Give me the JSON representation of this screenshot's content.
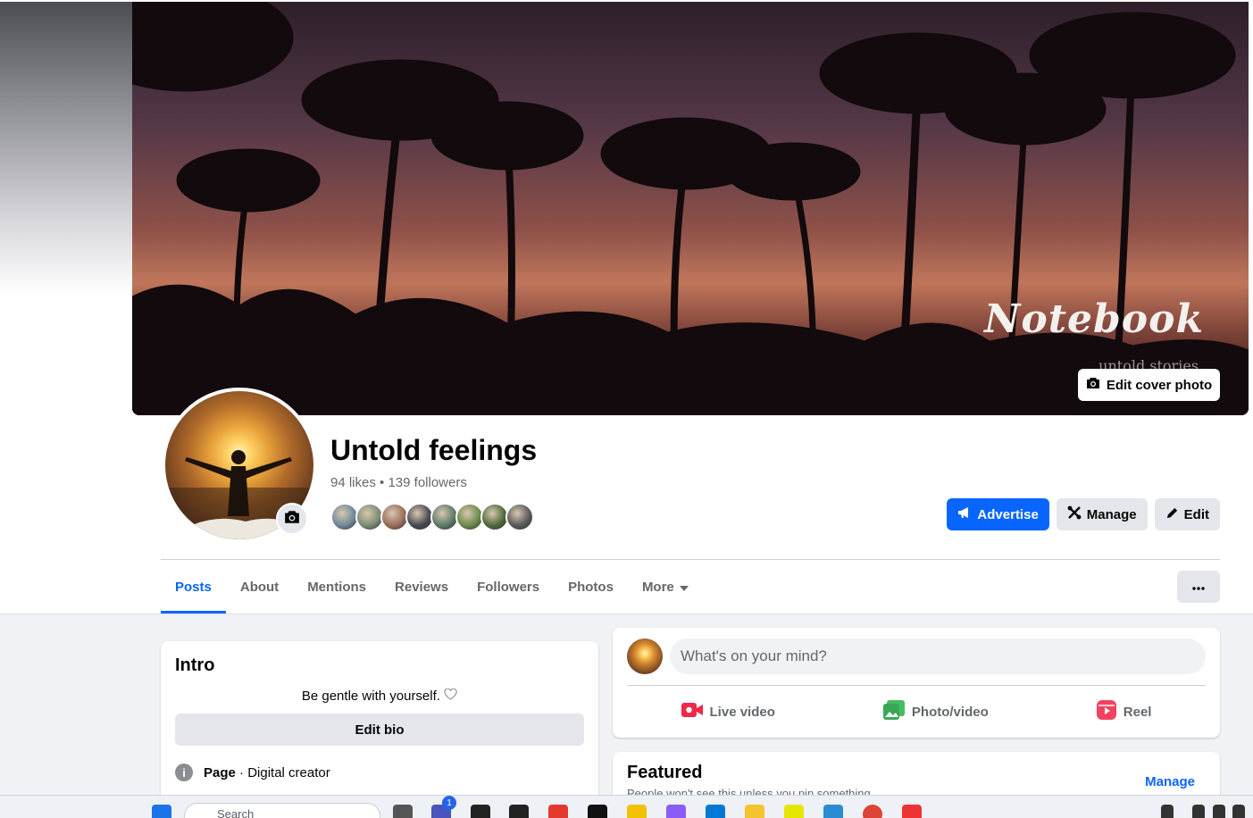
{
  "cover": {
    "brand": "Notebook",
    "subtitle": "untold stories",
    "edit_label": "Edit cover photo"
  },
  "profile": {
    "name": "Untold feelings",
    "likes": "94 likes",
    "separator": " • ",
    "followers": "139 followers"
  },
  "actions": {
    "advertise": "Advertise",
    "manage": "Manage",
    "edit": "Edit"
  },
  "tabs": [
    {
      "label": "Posts",
      "active": true
    },
    {
      "label": "About"
    },
    {
      "label": "Mentions"
    },
    {
      "label": "Reviews"
    },
    {
      "label": "Followers"
    },
    {
      "label": "Photos"
    },
    {
      "label": "More"
    }
  ],
  "intro": {
    "title": "Intro",
    "bio": "Be gentle with yourself.",
    "edit_bio": "Edit bio",
    "page_label": "Page",
    "page_category": " · Digital creator"
  },
  "composer": {
    "placeholder": "What's on your mind?",
    "live_video": "Live video",
    "photo_video": "Photo/video",
    "reel": "Reel"
  },
  "featured": {
    "title": "Featured",
    "subtitle": "People won't see this unless you pin something.",
    "manage": "Manage"
  },
  "taskbar": {
    "search_placeholder": "Search",
    "badge_count": "1"
  },
  "colors": {
    "accent": "#0866ff",
    "secondary_button": "#e4e6eb",
    "muted_text": "#65676b",
    "live_video": "#f02849",
    "photo_video": "#45bd62",
    "reel": "#f3425f"
  },
  "follower_faces": [
    "#6f8a9a",
    "#7d8c75",
    "#9a6e5a",
    "#4a4a55",
    "#5d7a6a",
    "#6c8a4e",
    "#506b3a",
    "#5a5a5a"
  ]
}
